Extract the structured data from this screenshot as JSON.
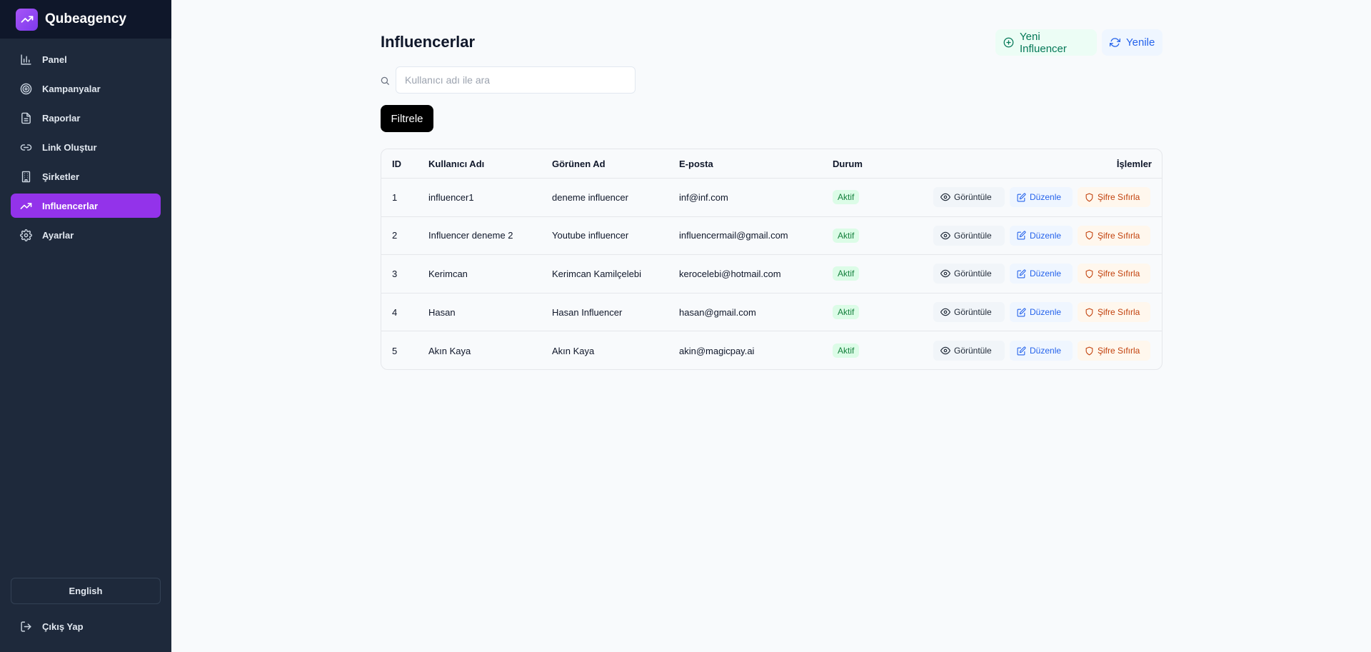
{
  "brand": {
    "name": "Qubeagency",
    "icon": "trending-up-icon"
  },
  "sidebar": {
    "items": [
      {
        "label": "Panel",
        "icon": "bar-chart-icon",
        "active": false
      },
      {
        "label": "Kampanyalar",
        "icon": "target-icon",
        "active": false
      },
      {
        "label": "Raporlar",
        "icon": "file-text-icon",
        "active": false
      },
      {
        "label": "Link Oluştur",
        "icon": "link-icon",
        "active": false
      },
      {
        "label": "Şirketler",
        "icon": "building-icon",
        "active": false
      },
      {
        "label": "Influencerlar",
        "icon": "trending-up-icon",
        "active": true
      },
      {
        "label": "Ayarlar",
        "icon": "gear-icon",
        "active": false
      }
    ],
    "language_label": "English",
    "logout_label": "Çıkış Yap"
  },
  "page": {
    "title": "Influencerlar",
    "new_button_label": "Yeni Influencer",
    "refresh_button_label": "Yenile",
    "search_placeholder": "Kullanıcı adı ile ara",
    "search_value": "",
    "filter_button_label": "Filtrele"
  },
  "table": {
    "headers": {
      "id": "ID",
      "username": "Kullanıcı Adı",
      "display_name": "Görünen Ad",
      "email": "E-posta",
      "status": "Durum",
      "actions": "İşlemler"
    },
    "action_labels": {
      "view": "Görüntüle",
      "edit": "Düzenle",
      "reset": "Şifre Sıfırla"
    },
    "rows": [
      {
        "id": "1",
        "username": "influencer1",
        "display_name": "deneme influencer",
        "email": "inf@inf.com",
        "status": "Aktif"
      },
      {
        "id": "2",
        "username": "Influencer deneme 2",
        "display_name": "Youtube influencer",
        "email": "influencermail@gmail.com",
        "status": "Aktif"
      },
      {
        "id": "3",
        "username": "Kerimcan",
        "display_name": "Kerimcan Kamilçelebi",
        "email": "kerocelebi@hotmail.com",
        "status": "Aktif"
      },
      {
        "id": "4",
        "username": "Hasan",
        "display_name": "Hasan Influencer",
        "email": "hasan@gmail.com",
        "status": "Aktif"
      },
      {
        "id": "5",
        "username": "Akın Kaya",
        "display_name": "Akın Kaya",
        "email": "akin@magicpay.ai",
        "status": "Aktif"
      }
    ]
  },
  "colors": {
    "sidebar_bg": "#1e293b",
    "brand_bg": "#0f172a",
    "accent": "#9333ea",
    "status_active_bg": "#dcfce7",
    "status_active_fg": "#15803d"
  }
}
